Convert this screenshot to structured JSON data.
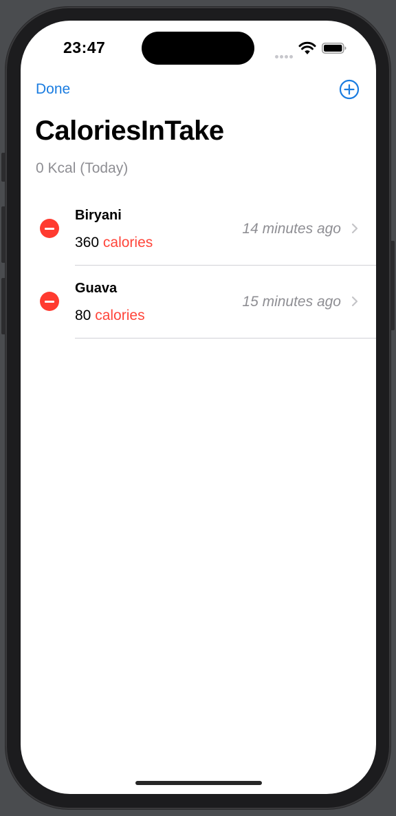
{
  "status_bar": {
    "time": "23:47",
    "icons": [
      "cellular-signal-icon",
      "wifi-icon",
      "battery-icon"
    ]
  },
  "nav": {
    "done_label": "Done",
    "add_icon": "plus-circle-icon"
  },
  "header": {
    "title": "CaloriesInTake",
    "subtitle": "0 Kcal (Today)"
  },
  "entries": [
    {
      "name": "Biryani",
      "calories": "360",
      "unit": "calories",
      "time": "14 minutes ago"
    },
    {
      "name": "Guava",
      "calories": "80",
      "unit": "calories",
      "time": "15 minutes ago"
    }
  ],
  "colors": {
    "accent": "#1a7ce0",
    "delete": "#ff3b30",
    "calorie_unit": "#ff453a",
    "secondary_text": "#8e8e93"
  }
}
